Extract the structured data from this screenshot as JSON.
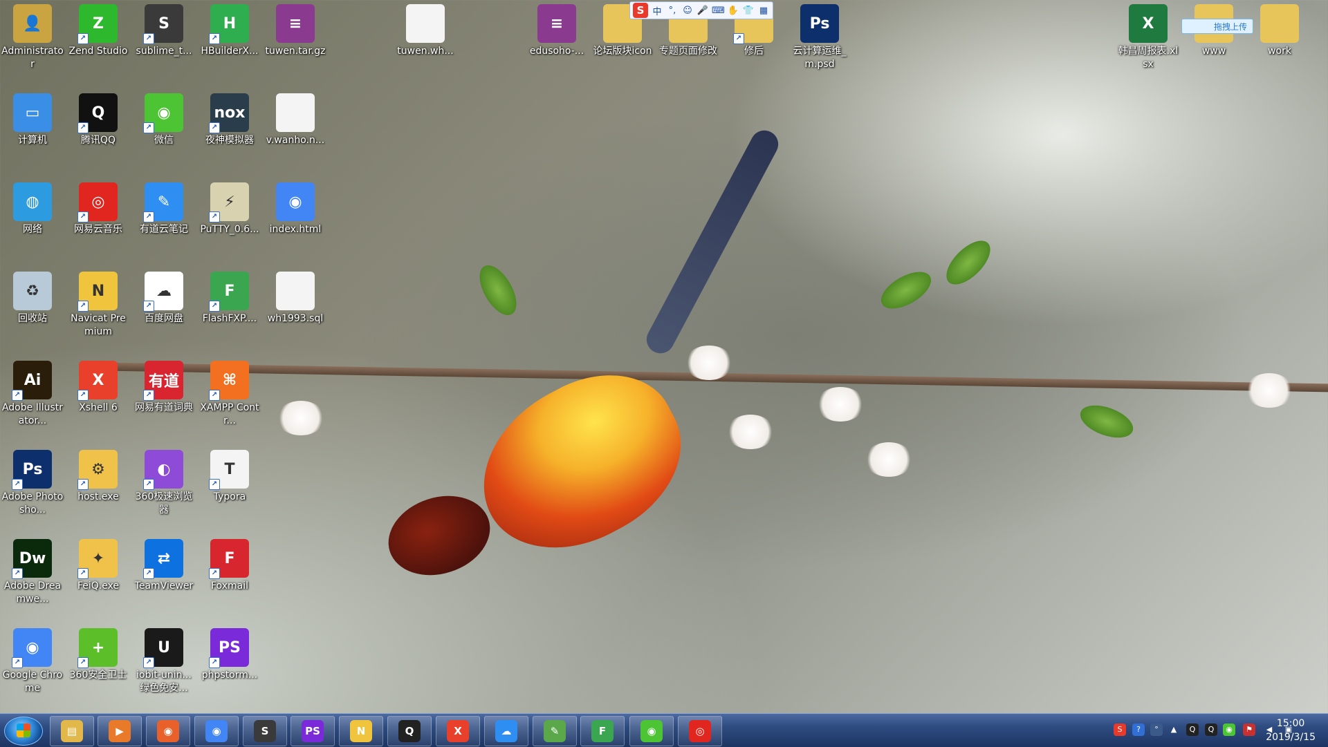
{
  "icons": [
    {
      "id": "administrator",
      "label": "Administrator",
      "icon": "user-folder-icon",
      "color": "#c9a441"
    },
    {
      "id": "zend",
      "label": "Zend Studio",
      "icon": "zend-studio-icon",
      "color": "#2db82d"
    },
    {
      "id": "sublime",
      "label": "sublime_t...",
      "icon": "sublime-text-icon",
      "color": "#3a3a3a"
    },
    {
      "id": "hbuilder",
      "label": "HBuilderX...",
      "icon": "hbuilder-icon",
      "color": "#2fae4f"
    },
    {
      "id": "tuwen-tar",
      "label": "tuwen.tar.gz",
      "icon": "winrar-archive-icon",
      "color": "#8a3b8f"
    },
    {
      "id": "tuwen-wh",
      "label": "tuwen.wh...",
      "icon": "blank-file-icon",
      "color": "#f4f4f4"
    },
    {
      "id": "edusoho",
      "label": "edusoho-...",
      "icon": "winrar-archive-icon",
      "color": "#8a3b8f"
    },
    {
      "id": "forum-icon",
      "label": "论坛版块icon",
      "icon": "folder-icon",
      "color": "#e8c55a"
    },
    {
      "id": "special-page",
      "label": "专题页面修改",
      "icon": "folder-icon",
      "color": "#e8c55a"
    },
    {
      "id": "xiuhou",
      "label": "修后",
      "icon": "folder-icon",
      "color": "#e8c55a"
    },
    {
      "id": "cloud-psd",
      "label": "云计算运维_m.psd",
      "icon": "photoshop-psd-icon",
      "color": "#0d2f6b"
    },
    {
      "id": "hanchang",
      "label": "韩昌周报表.xlsx",
      "icon": "excel-file-icon",
      "color": "#1f7a3f"
    },
    {
      "id": "www",
      "label": "www",
      "icon": "folder-icon",
      "color": "#e8c55a"
    },
    {
      "id": "work",
      "label": "work",
      "icon": "folder-icon",
      "color": "#e8c55a"
    },
    {
      "id": "computer",
      "label": "计算机",
      "icon": "computer-icon",
      "color": "#3a8ee6"
    },
    {
      "id": "qq",
      "label": "腾讯QQ",
      "icon": "qq-penguin-icon",
      "color": "#111111"
    },
    {
      "id": "wechat",
      "label": "微信",
      "icon": "wechat-icon",
      "color": "#4cc433"
    },
    {
      "id": "nox",
      "label": "夜神模拟器",
      "icon": "nox-player-icon",
      "color": "#2a3d4a"
    },
    {
      "id": "vwanho",
      "label": "v.wanho.n...",
      "icon": "blank-file-icon",
      "color": "#f4f4f4"
    },
    {
      "id": "network",
      "label": "网络",
      "icon": "network-globe-icon",
      "color": "#2d9be0"
    },
    {
      "id": "netease-music",
      "label": "网易云音乐",
      "icon": "netease-music-icon",
      "color": "#e0261f"
    },
    {
      "id": "youdao-note",
      "label": "有道云笔记",
      "icon": "youdao-note-icon",
      "color": "#2f8ef2"
    },
    {
      "id": "putty",
      "label": "PuTTY_0.6...",
      "icon": "putty-icon",
      "color": "#d8d2b0"
    },
    {
      "id": "index-html",
      "label": "index.html",
      "icon": "chrome-icon",
      "color": "#4285f4"
    },
    {
      "id": "recycle",
      "label": "回收站",
      "icon": "recycle-bin-icon",
      "color": "#b8c9d8"
    },
    {
      "id": "navicat",
      "label": "Navicat Premium",
      "icon": "navicat-icon",
      "color": "#f0c53d"
    },
    {
      "id": "baidu-pan",
      "label": "百度网盘",
      "icon": "baidu-netdisk-icon",
      "color": "#ffffff"
    },
    {
      "id": "flashfxp",
      "label": "FlashFXP....",
      "icon": "flashfxp-icon",
      "color": "#3aa650"
    },
    {
      "id": "wh1993",
      "label": "wh1993.sql",
      "icon": "blank-file-icon",
      "color": "#f4f4f4"
    },
    {
      "id": "illustrator",
      "label": "Adobe Illustrator...",
      "icon": "illustrator-icon",
      "color": "#2a1d0a"
    },
    {
      "id": "xshell",
      "label": "Xshell 6",
      "icon": "xshell-icon",
      "color": "#e8402a"
    },
    {
      "id": "youdao-dict",
      "label": "网易有道词典",
      "icon": "youdao-dict-icon",
      "color": "#d8252f"
    },
    {
      "id": "xampp",
      "label": "XAMPP Contr...",
      "icon": "xampp-icon",
      "color": "#f37021"
    },
    {
      "id": "photoshop",
      "label": "Adobe Photosho...",
      "icon": "photoshop-icon",
      "color": "#0d2f6b"
    },
    {
      "id": "host",
      "label": "host.exe",
      "icon": "gear-icon",
      "color": "#f1c24a"
    },
    {
      "id": "browser360",
      "label": "360极速浏览器",
      "icon": "browser-360-icon",
      "color": "#8d4bd8"
    },
    {
      "id": "typora",
      "label": "Typora",
      "icon": "typora-icon",
      "color": "#f4f4f4"
    },
    {
      "id": "dreamweaver",
      "label": "Adobe Dreamwe...",
      "icon": "dreamweaver-icon",
      "color": "#0b2a0b"
    },
    {
      "id": "feiq",
      "label": "FeiQ.exe",
      "icon": "feiq-icon",
      "color": "#f1c24a"
    },
    {
      "id": "teamviewer",
      "label": "TeamViewer",
      "icon": "teamviewer-icon",
      "color": "#0e71e0"
    },
    {
      "id": "foxmail",
      "label": "Foxmail",
      "icon": "foxmail-icon",
      "color": "#d8262f"
    },
    {
      "id": "chrome",
      "label": "Google Chrome",
      "icon": "chrome-icon",
      "color": "#4285f4"
    },
    {
      "id": "safe360",
      "label": "360安全卫士",
      "icon": "safe-360-icon",
      "color": "#5cbf2a"
    },
    {
      "id": "iobit",
      "label": "iobit-unin... 绿色免安...",
      "icon": "iobit-uninstaller-icon",
      "color": "#1a1a1a"
    },
    {
      "id": "phpstorm",
      "label": "phpstorm...",
      "icon": "phpstorm-icon",
      "color": "#7a2ad8"
    }
  ],
  "glyphs": {
    "administrator": "👤",
    "zend": "Z",
    "sublime": "S",
    "hbuilder": "H",
    "tuwen-tar": "≡",
    "tuwen-wh": "",
    "edusoho": "≡",
    "forum-icon": "",
    "special-page": "",
    "xiuhou": "",
    "cloud-psd": "Ps",
    "hanchang": "X",
    "www": "",
    "work": "",
    "computer": "▭",
    "qq": "Q",
    "wechat": "◉",
    "nox": "nox",
    "vwanho": "",
    "network": "◍",
    "netease-music": "◎",
    "youdao-note": "✎",
    "putty": "⚡",
    "index-html": "◉",
    "recycle": "♻",
    "navicat": "N",
    "baidu-pan": "☁",
    "flashfxp": "F",
    "wh1993": "",
    "illustrator": "Ai",
    "xshell": "X",
    "youdao-dict": "有道",
    "xampp": "⌘",
    "photoshop": "Ps",
    "host": "⚙",
    "browser360": "◐",
    "typora": "T",
    "dreamweaver": "Dw",
    "feiq": "✦",
    "teamviewer": "⇄",
    "foxmail": "F",
    "chrome": "◉",
    "safe360": "+",
    "iobit": "U",
    "phpstorm": "PS"
  },
  "ime": {
    "logo": "S",
    "items": [
      "中",
      "°,",
      "☺",
      "🎤",
      "⌨",
      "✋",
      "👕",
      "▦"
    ]
  },
  "upload_badge": "拖拽上传",
  "taskbar": {
    "buttons": [
      {
        "id": "explorer",
        "icon": "file-explorer-icon",
        "glyph": "▤",
        "color": "#e2b84a"
      },
      {
        "id": "media",
        "icon": "media-player-icon",
        "glyph": "▶",
        "color": "#e87a2a"
      },
      {
        "id": "firefox",
        "icon": "firefox-icon",
        "glyph": "◉",
        "color": "#e8602a"
      },
      {
        "id": "chrome",
        "icon": "chrome-icon",
        "glyph": "◉",
        "color": "#4285f4"
      },
      {
        "id": "sublime",
        "icon": "sublime-text-icon",
        "glyph": "S",
        "color": "#3a3a3a"
      },
      {
        "id": "phpstorm",
        "icon": "phpstorm-icon",
        "glyph": "PS",
        "color": "#7a2ad8"
      },
      {
        "id": "navicat",
        "icon": "navicat-icon",
        "glyph": "N",
        "color": "#f0c53d"
      },
      {
        "id": "qq",
        "icon": "qq-penguin-icon",
        "glyph": "Q",
        "color": "#222222"
      },
      {
        "id": "xshell",
        "icon": "xshell-icon",
        "glyph": "X",
        "color": "#e8402a"
      },
      {
        "id": "baidu",
        "icon": "baidu-netdisk-icon",
        "glyph": "☁",
        "color": "#2f8ef2"
      },
      {
        "id": "notepad",
        "icon": "notepad-icon",
        "glyph": "✎",
        "color": "#5aa84a"
      },
      {
        "id": "flashfxp",
        "icon": "flashfxp-icon",
        "glyph": "F",
        "color": "#3aa650"
      },
      {
        "id": "wechat",
        "icon": "wechat-icon",
        "glyph": "◉",
        "color": "#4cc433"
      },
      {
        "id": "netease",
        "icon": "netease-music-icon",
        "glyph": "◎",
        "color": "#e0261f"
      }
    ],
    "tray": [
      {
        "icon": "sogou-ime-icon",
        "glyph": "S",
        "color": "#e8392a"
      },
      {
        "icon": "help-icon",
        "glyph": "?",
        "color": "#2f6fd6"
      },
      {
        "icon": "ime-mode-icon",
        "glyph": "°",
        "color": "#3a5a8a"
      },
      {
        "icon": "chevron-up-icon",
        "glyph": "▲",
        "color": "transparent"
      },
      {
        "icon": "qq-tray-icon",
        "glyph": "Q",
        "color": "#222222"
      },
      {
        "icon": "qq-tray-icon-2",
        "glyph": "Q",
        "color": "#222222"
      },
      {
        "icon": "wechat-tray-icon",
        "glyph": "◉",
        "color": "#4cc433"
      },
      {
        "icon": "action-center-flag-icon",
        "glyph": "⚑",
        "color": "#c93030"
      },
      {
        "icon": "volume-icon",
        "glyph": "◀",
        "color": "transparent"
      },
      {
        "icon": "network-tray-icon",
        "glyph": "▣",
        "color": "transparent"
      }
    ],
    "time": "15:00",
    "date": "2019/3/15"
  }
}
